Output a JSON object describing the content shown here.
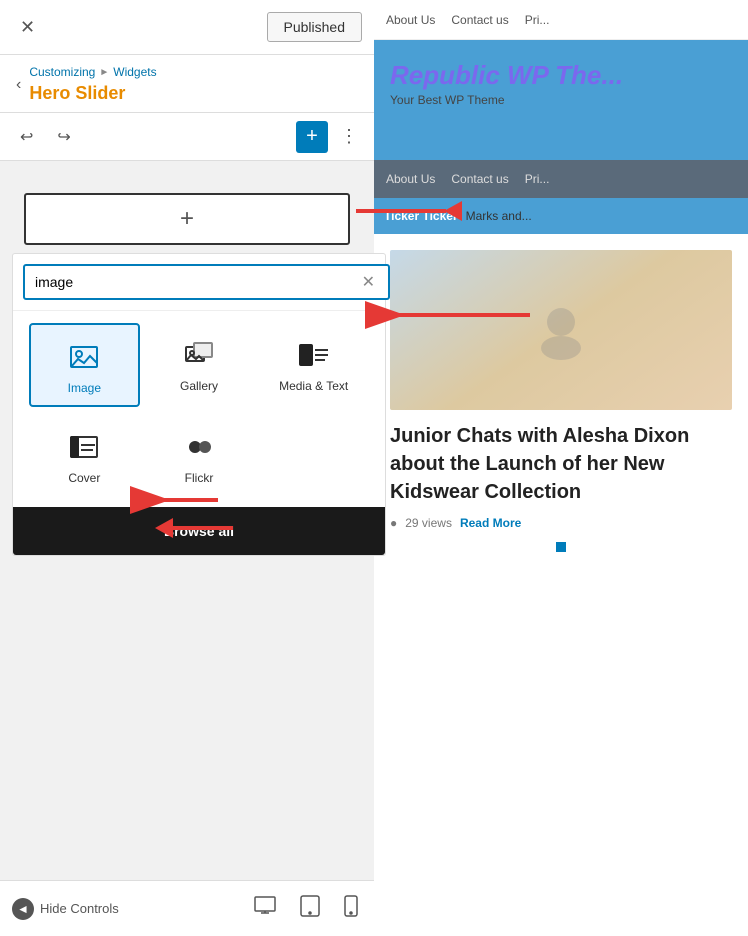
{
  "topbar": {
    "close_label": "✕",
    "published_label": "Published"
  },
  "breadcrumb": {
    "customizing": "Customizing",
    "separator": "►",
    "widgets": "Widgets",
    "title": "Hero Slider"
  },
  "toolbar": {
    "undo_label": "↩",
    "redo_label": "↪",
    "add_label": "+",
    "more_label": "⋮"
  },
  "add_block": {
    "plus_label": "+"
  },
  "search": {
    "placeholder": "image",
    "value": "image",
    "clear_label": "✕"
  },
  "blocks": [
    {
      "id": "image",
      "label": "Image",
      "selected": true
    },
    {
      "id": "gallery",
      "label": "Gallery",
      "selected": false
    },
    {
      "id": "media-text",
      "label": "Media & Text",
      "selected": false
    },
    {
      "id": "cover",
      "label": "Cover",
      "selected": false
    },
    {
      "id": "flickr",
      "label": "Flickr",
      "selected": false
    }
  ],
  "browse_all": "Browse all",
  "bottom": {
    "hide_controls": "Hide Controls",
    "device_desktop": "🖥",
    "device_tablet": "▭",
    "device_mobile": "📱"
  },
  "preview": {
    "nav_links": [
      "About Us",
      "Contact us",
      "Pri..."
    ],
    "hero_title": "Republic WP The...",
    "hero_sub": "Your Best WP Theme",
    "nav2_links": [
      "About Us",
      "Contact us",
      "Pri..."
    ],
    "ticker_label": "Ticker Ticker",
    "ticker_text": "Marks and...",
    "article_title": "Junior Chats with Alesha Dixon about the Launch of her New Kidswear Collection",
    "article_views": "29 views",
    "read_more": "Read More"
  }
}
